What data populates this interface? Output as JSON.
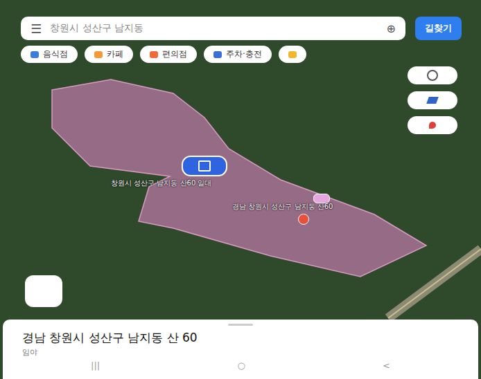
{
  "search": {
    "value": "창원시 성산구 남지동",
    "menu_icon": "☰",
    "mic_icon": "⊕"
  },
  "directions_button": {
    "label": "길찾기"
  },
  "chips": [
    {
      "label": "음식점",
      "color": "#3b7dd8"
    },
    {
      "label": "카페",
      "color": "#f29b38"
    },
    {
      "label": "편의점",
      "color": "#f06a3a"
    },
    {
      "label": "주차·충전",
      "color": "#3b6fd8"
    },
    {
      "label": "",
      "color": "#f2b632"
    }
  ],
  "map": {
    "labels": [
      {
        "text": "창원시 성산구 남지동 산60 일대"
      },
      {
        "text": "경남 창원시 성산구 남지동 산60"
      }
    ]
  },
  "place": {
    "address": "경남 창원시 성산구 남지동 산 60",
    "category": "임야"
  },
  "nav_bar": [
    "|||",
    "○",
    "<"
  ]
}
